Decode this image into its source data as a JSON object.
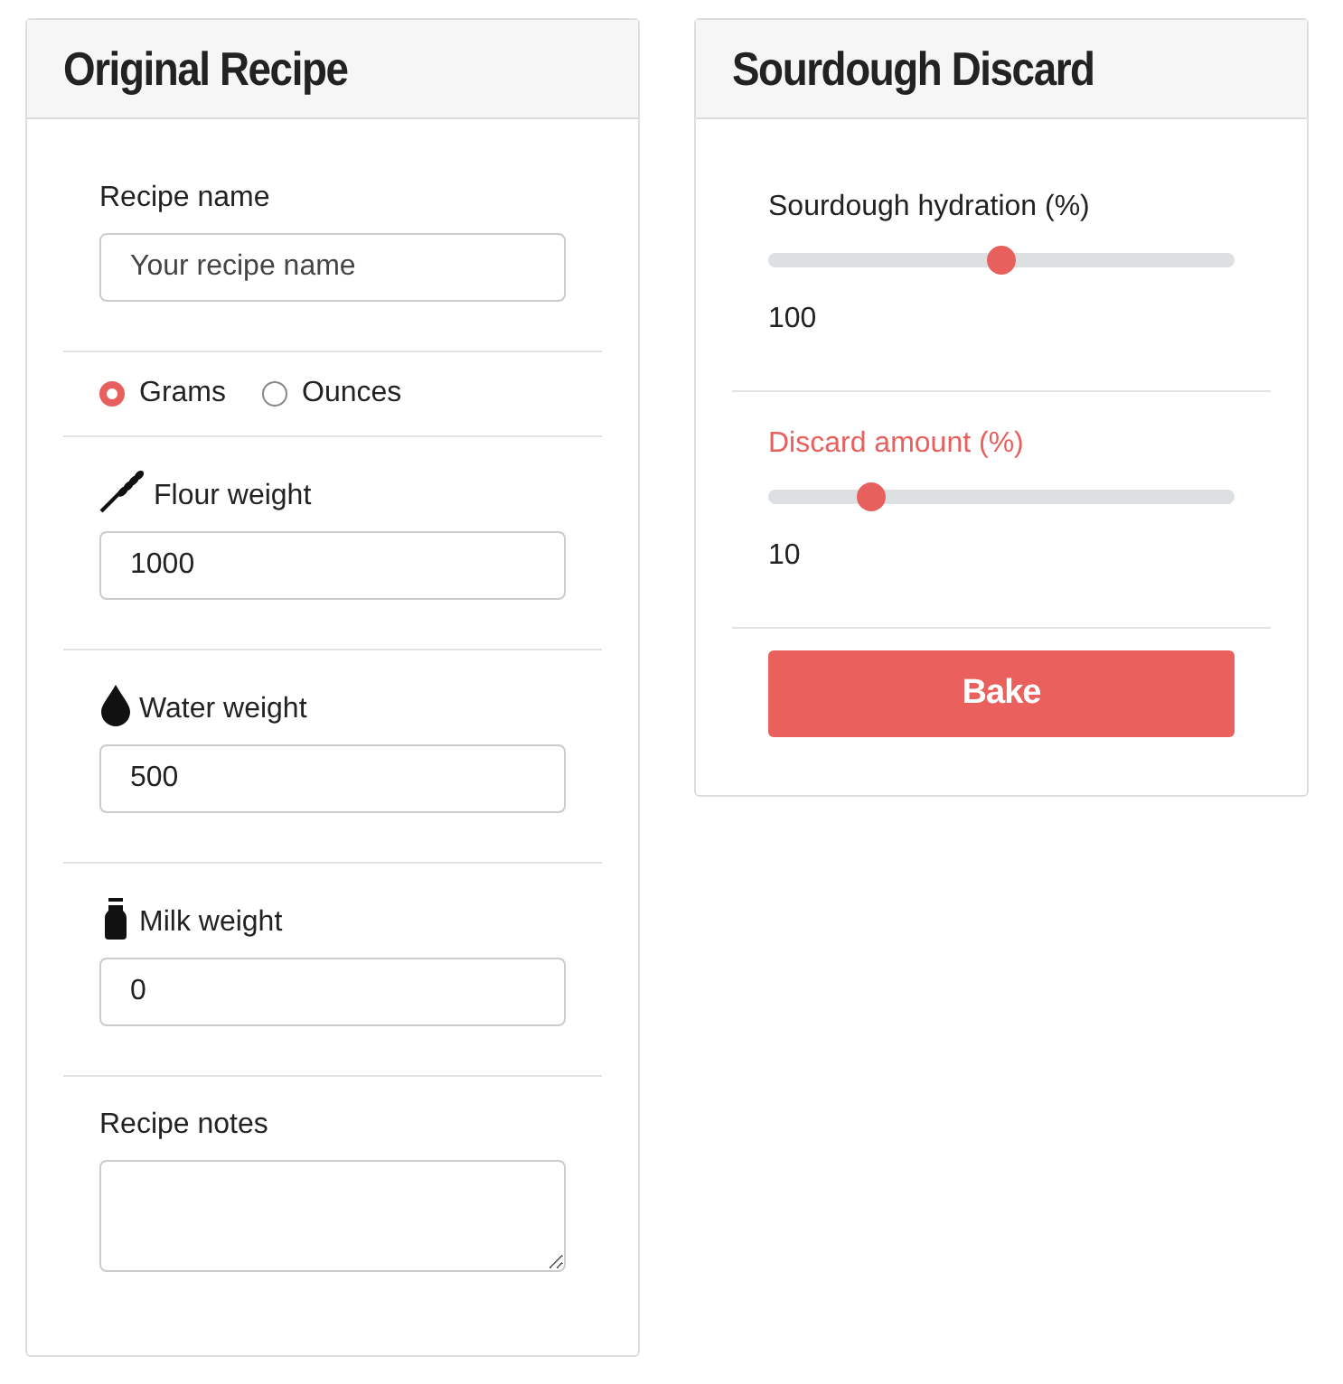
{
  "original_recipe": {
    "title": "Original Recipe",
    "recipe_name": {
      "label": "Recipe name",
      "placeholder": "Your recipe name"
    },
    "units": [
      {
        "label": "Grams",
        "selected": true
      },
      {
        "label": "Ounces",
        "selected": false
      }
    ],
    "flour_weight": {
      "label": "Flour weight",
      "value": "1000"
    },
    "water_weight": {
      "label": "Water weight",
      "value": "500"
    },
    "milk_weight": {
      "label": "Milk weight",
      "value": "0"
    },
    "recipe_notes": {
      "label": "Recipe notes"
    }
  },
  "sourdough_discard": {
    "title": "Sourdough Discard",
    "sliders": [
      {
        "label": "Sourdough hydration (%)",
        "highlighted": false,
        "level": 0.5,
        "reading": "100"
      },
      {
        "label": "Discard amount (%)",
        "highlighted": true,
        "level": 0.22,
        "reading": "10"
      }
    ],
    "button": "Bake"
  }
}
